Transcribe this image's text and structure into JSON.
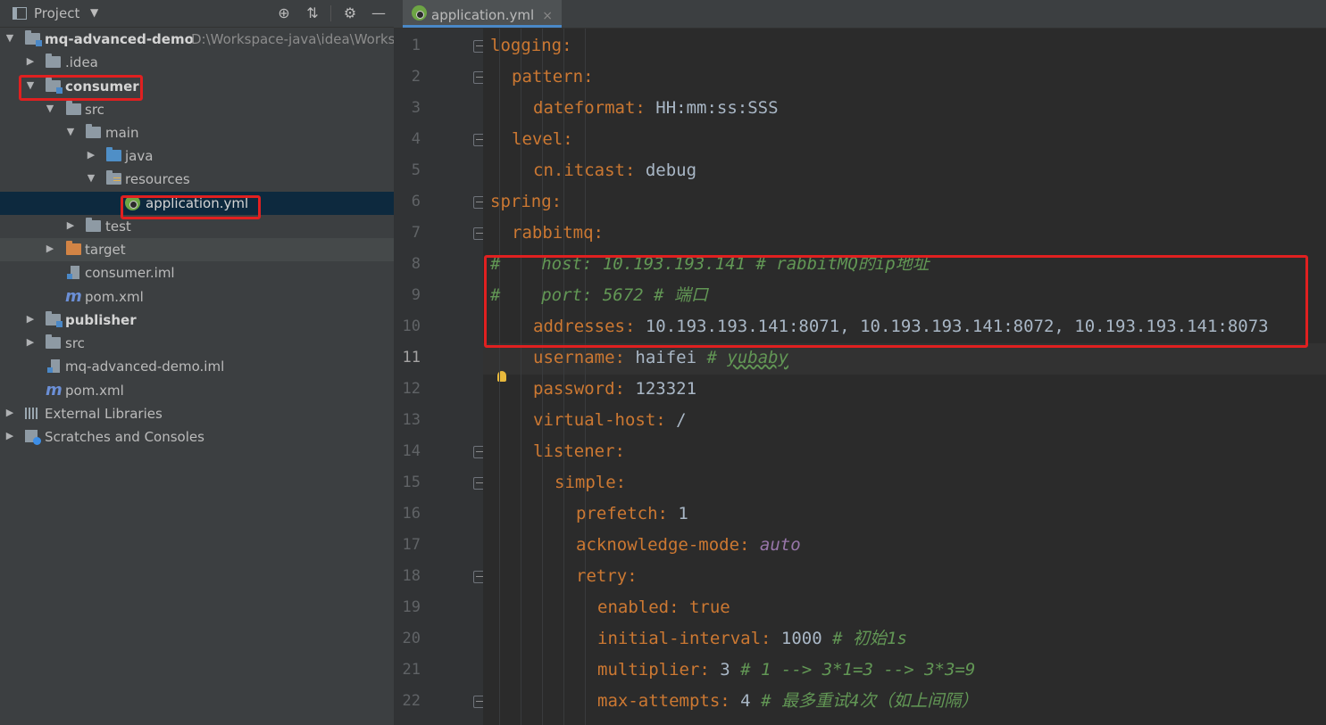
{
  "panel": {
    "title": "Project",
    "icons": [
      "locate-icon",
      "collapse-icon",
      "gear-icon",
      "minimize-icon"
    ]
  },
  "tree": [
    {
      "label": "mq-advanced-demo",
      "path": "D:\\Workspace-java\\idea\\Works",
      "expanded": true
    },
    {
      "label": ".idea",
      "expanded": false
    },
    {
      "label": "consumer",
      "expanded": true
    },
    {
      "label": "src",
      "expanded": true
    },
    {
      "label": "main",
      "expanded": true
    },
    {
      "label": "java",
      "expanded": false
    },
    {
      "label": "resources",
      "expanded": true
    },
    {
      "label": "application.yml",
      "selected": true
    },
    {
      "label": "test",
      "expanded": false
    },
    {
      "label": "target",
      "expanded": false
    },
    {
      "label": "consumer.iml"
    },
    {
      "label": "pom.xml"
    },
    {
      "label": "publisher",
      "expanded": false
    },
    {
      "label": "src",
      "expanded": false
    },
    {
      "label": "mq-advanced-demo.iml"
    },
    {
      "label": "pom.xml"
    },
    {
      "label": "External Libraries",
      "expanded": false
    },
    {
      "label": "Scratches and Consoles",
      "expanded": false
    }
  ],
  "editor": {
    "tab": {
      "label": "application.yml",
      "close": "×"
    },
    "current_line": 11,
    "line_numbers": [
      "1",
      "2",
      "3",
      "4",
      "5",
      "6",
      "7",
      "8",
      "9",
      "10",
      "11",
      "12",
      "13",
      "14",
      "15",
      "16",
      "17",
      "18",
      "19",
      "20",
      "21",
      "22"
    ],
    "code": [
      {
        "key": "logging",
        "colon": ":"
      },
      {
        "key": "pattern",
        "colon": ":"
      },
      {
        "key": "dateformat",
        "colon": ":",
        "val": " HH:mm:ss:SSS"
      },
      {
        "key": "level",
        "colon": ":"
      },
      {
        "key": "cn.itcast",
        "colon": ":",
        "val": " debug"
      },
      {
        "key": "spring",
        "colon": ":"
      },
      {
        "key": "rabbitmq",
        "colon": ":"
      },
      {
        "comment": "#    host: 10.193.193.141 # rabbitMQ的ip地址"
      },
      {
        "comment": "#    port: 5672 # 端口"
      },
      {
        "key": "addresses",
        "colon": ":",
        "val": " 10.193.193.141:8071, 10.193.193.141:8072, 10.193.193.141:8073"
      },
      {
        "key": "username",
        "colon": ":",
        "val": " haifei ",
        "comment": "# ",
        "comment_u": "yubaby"
      },
      {
        "key": "password",
        "colon": ":",
        "val": " 123321"
      },
      {
        "key": "virtual-host",
        "colon": ":",
        "val": " /"
      },
      {
        "key": "listener",
        "colon": ":"
      },
      {
        "key": "simple",
        "colon": ":"
      },
      {
        "key": "prefetch",
        "colon": ":",
        "val": " 1"
      },
      {
        "key": "acknowledge-mode",
        "colon": ":",
        "purple": " auto"
      },
      {
        "key": "retry",
        "colon": ":"
      },
      {
        "key": "enabled",
        "colon": ":",
        "kw": " true"
      },
      {
        "key": "initial-interval",
        "colon": ":",
        "val": " 1000 ",
        "comment": "# 初始1s"
      },
      {
        "key": "multiplier",
        "colon": ":",
        "val": " 3 ",
        "comment": "# 1 --> 3*1=3 --> 3*3=9"
      },
      {
        "key": "max-attempts",
        "colon": ":",
        "val": " 4 ",
        "comment": "# 最多重试4次（如上间隔）"
      }
    ]
  },
  "colors": {
    "key": "#cc7832",
    "comment": "#629755",
    "value": "#a9b7c6",
    "highlight": "#e02020",
    "selection": "#0d293e"
  }
}
